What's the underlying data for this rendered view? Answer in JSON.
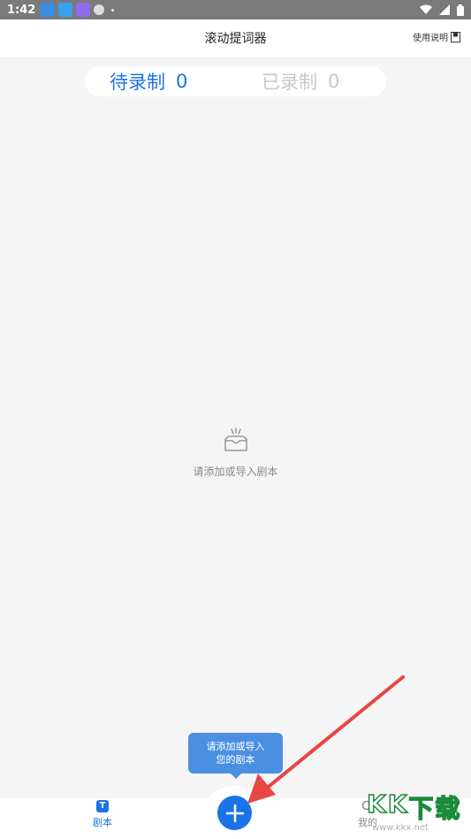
{
  "status_bar": {
    "time": "1:42",
    "icons": [
      "app-notification-icon",
      "app-notification-icon",
      "app-notification-icon",
      "clock-icon"
    ],
    "right_icons": [
      "wifi-icon",
      "signal-icon",
      "battery-icon"
    ]
  },
  "header": {
    "title": "滚动提词器",
    "help_label": "使用说明",
    "help_icon": "document-icon"
  },
  "tabs": [
    {
      "label": "待录制",
      "count": "0",
      "active": true
    },
    {
      "label": "已录制",
      "count": "0",
      "active": false
    }
  ],
  "empty_state": {
    "icon": "inbox-icon",
    "message": "请添加或导入剧本"
  },
  "tooltip": {
    "line1": "请添加或导入",
    "line2": "您的剧本"
  },
  "bottom_nav": {
    "script_label": "剧本",
    "script_icon_glyph": "T",
    "mine_label": "我的"
  },
  "fab": {
    "icon": "plus-icon"
  },
  "watermark": {
    "letters": [
      "K",
      "K",
      "下",
      "载"
    ],
    "url": "www.kkx.net"
  },
  "colors": {
    "accent": "#1a73e8",
    "tooltip": "#4a90e2",
    "inactive": "#c7c7c7",
    "arrow": "#e84545",
    "background": "#f5f5f5"
  }
}
